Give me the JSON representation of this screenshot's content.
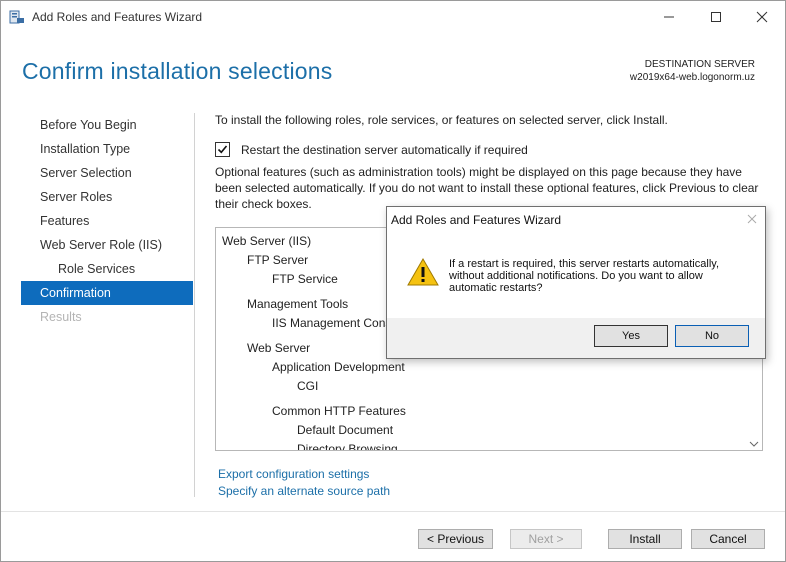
{
  "window": {
    "title": "Add Roles and Features Wizard",
    "icon": "server-manager-icon"
  },
  "header": {
    "title": "Confirm installation selections",
    "destination_label": "DESTINATION SERVER",
    "destination_server": "w2019x64-web.logonorm.uz"
  },
  "nav": {
    "items": [
      {
        "label": "Before You Begin",
        "state": "normal"
      },
      {
        "label": "Installation Type",
        "state": "normal"
      },
      {
        "label": "Server Selection",
        "state": "normal"
      },
      {
        "label": "Server Roles",
        "state": "normal"
      },
      {
        "label": "Features",
        "state": "normal"
      },
      {
        "label": "Web Server Role (IIS)",
        "state": "normal"
      },
      {
        "label": "Role Services",
        "state": "sub"
      },
      {
        "label": "Confirmation",
        "state": "active"
      },
      {
        "label": "Results",
        "state": "disabled"
      }
    ]
  },
  "main": {
    "intro": "To install the following roles, role services, or features on selected server, click Install.",
    "restart_label": "Restart the destination server automatically if required",
    "restart_checked": true,
    "optional_note": "Optional features (such as administration tools) might be displayed on this page because they have been selected automatically. If you do not want to install these optional features, click Previous to clear their check boxes.",
    "features": [
      {
        "label": "Web Server (IIS)",
        "level": 0
      },
      {
        "label": "FTP Server",
        "level": 1
      },
      {
        "label": "FTP Service",
        "level": 2
      },
      {
        "label": "Management Tools",
        "level": 1
      },
      {
        "label": "IIS Management Console",
        "level": 2
      },
      {
        "label": "Web Server",
        "level": 1
      },
      {
        "label": "Application Development",
        "level": 2
      },
      {
        "label": "CGI",
        "level": 3
      },
      {
        "label": "Common HTTP Features",
        "level": 2
      },
      {
        "label": "Default Document",
        "level": 3
      },
      {
        "label": "Directory Browsing",
        "level": 3
      }
    ],
    "export_link": "Export configuration settings",
    "alt_source_link": "Specify an alternate source path"
  },
  "buttons": {
    "previous": "< Previous",
    "next": "Next >",
    "install": "Install",
    "cancel": "Cancel"
  },
  "dialog": {
    "title": "Add Roles and Features Wizard",
    "message": "If a restart is required, this server restarts automatically, without additional notifications. Do you want to allow automatic restarts?",
    "icon": "warning-icon",
    "yes": "Yes",
    "no": "No"
  }
}
